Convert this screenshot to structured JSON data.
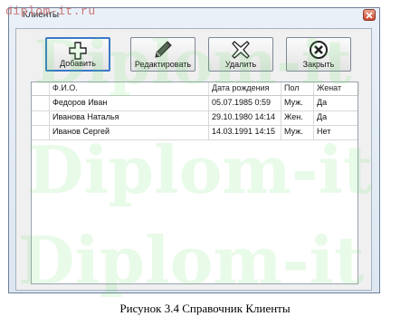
{
  "watermark": {
    "domain_text": "diplom-it.ru",
    "bg_text": "Diplom-it"
  },
  "window": {
    "title": "Клиенты",
    "close_icon": "close-icon"
  },
  "toolbar": {
    "buttons": [
      {
        "label": "Добавить",
        "icon": "plus-icon"
      },
      {
        "label": "Редактировать",
        "icon": "pencil-icon"
      },
      {
        "label": "Удалить",
        "icon": "x-mark-icon"
      },
      {
        "label": "Закрыть",
        "icon": "circle-close-icon"
      }
    ]
  },
  "grid": {
    "columns": [
      "Ф.И.О.",
      "Дата рождения",
      "Пол",
      "Женат"
    ],
    "rows": [
      [
        "Федоров Иван",
        "05.07.1985 0:59",
        "Муж.",
        "Да"
      ],
      [
        "Иванова Наталья",
        "29.10.1980 14:14",
        "Жен.",
        "Да"
      ],
      [
        "Иванов Сергей",
        "14.03.1991 14:15",
        "Муж.",
        "Нет"
      ]
    ]
  },
  "caption": "Рисунок 3.4 Справочник Клиенты"
}
